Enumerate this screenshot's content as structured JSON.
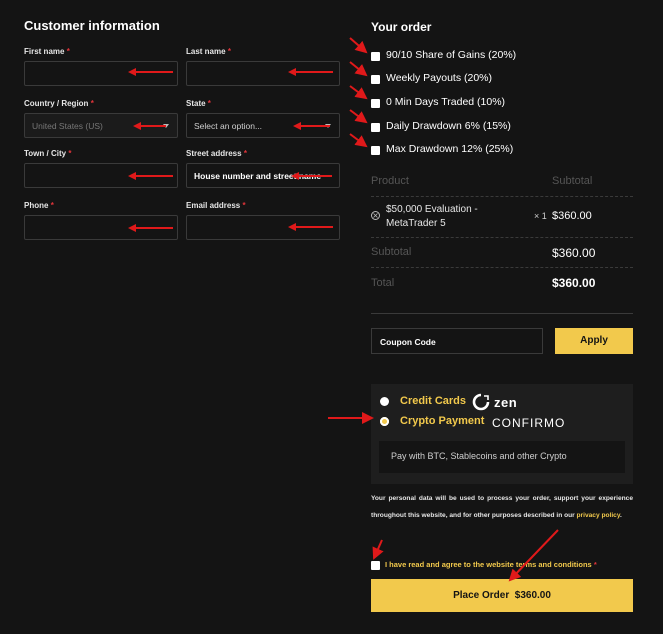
{
  "customer": {
    "title": "Customer information",
    "fields": [
      {
        "label": "First name",
        "required": "*",
        "value": ""
      },
      {
        "label": "Last name",
        "required": "*",
        "value": ""
      },
      {
        "label": "Country / Region",
        "required": "*",
        "value": "United States (US)"
      },
      {
        "label": "State",
        "required": "*",
        "value": "Select an option..."
      },
      {
        "label": "Town / City",
        "required": "*",
        "value": ""
      },
      {
        "label": "Street address",
        "required": "*",
        "placeholder": "House number and street name"
      },
      {
        "label": "Phone",
        "required": "*",
        "value": ""
      },
      {
        "label": "Email address",
        "required": "*",
        "value": ""
      }
    ]
  },
  "order": {
    "title": "Your order",
    "options": [
      {
        "label": "90/10 Share of Gains (20%)",
        "checked": false
      },
      {
        "label": "Weekly Payouts (20%)",
        "checked": false
      },
      {
        "label": "0 Min Days Traded (10%)",
        "checked": false
      },
      {
        "label": "Daily Drawdown 6% (15%)",
        "checked": false
      },
      {
        "label": "Max Drawdown 12% (25%)",
        "checked": false
      }
    ],
    "table": {
      "col_product": "Product",
      "col_subtotal": "Subtotal",
      "item_name_line1": "$50,000 Evaluation -",
      "item_name_line2": "MetaTrader 5",
      "item_qty": "× 1",
      "item_price": "$360.00",
      "subtotal_label": "Subtotal",
      "subtotal_value": "$360.00",
      "total_label": "Total",
      "total_value": "$360.00"
    },
    "coupon": {
      "placeholder": "Coupon Code",
      "apply_label": "Apply"
    },
    "payment": {
      "methods": [
        {
          "label": "Credit Cards",
          "brand": "zen",
          "selected": false
        },
        {
          "label": "Crypto Payment",
          "brand": "CONFIRMO",
          "selected": true
        }
      ],
      "description": "Pay with BTC, Stablecoins and other Crypto"
    },
    "privacy": {
      "text": "Your personal data will be used to process your order, support your experience throughout this website, and for other purposes described in our",
      "link": "privacy policy",
      "end": "."
    },
    "terms": {
      "label": "I have read and agree to the website terms and conditions",
      "required": "*"
    },
    "place_order": {
      "label": "Place Order",
      "amount": "$360.00"
    }
  },
  "colors": {
    "accent": "#f2c94c",
    "background": "#141414",
    "annotation": "#e0191a",
    "required": "#e0343a"
  }
}
